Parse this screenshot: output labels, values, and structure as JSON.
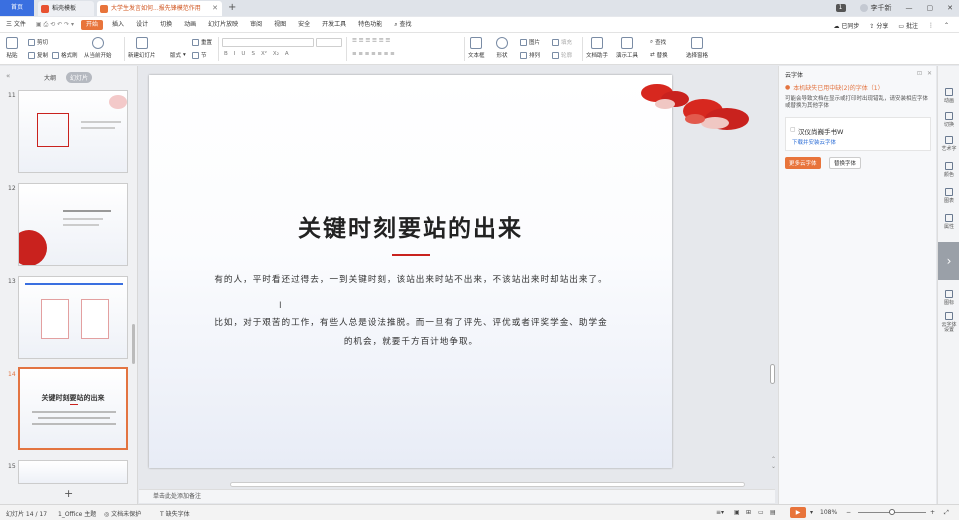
{
  "tabs": {
    "home": "首页",
    "docer": "稻壳模板",
    "ppt": "大学生发言如何...报先锋模范作用"
  },
  "window": {
    "badge": "1",
    "user": "李千新"
  },
  "menu": {
    "file": "三 文件",
    "items": [
      "开始",
      "插入",
      "设计",
      "切换",
      "动画",
      "幻灯片放映",
      "审阅",
      "视图",
      "安全",
      "开发工具",
      "特色功能"
    ],
    "search": "查找",
    "right": [
      "已同步",
      "分享",
      "批注"
    ]
  },
  "ribbon": {
    "paste": "粘贴",
    "cut": "剪切",
    "copy": "复制",
    "format_painter": "格式刷",
    "from_current": "从当前开始",
    "new_slide": "新建幻灯片",
    "layout": "版式",
    "section": "节",
    "reset": "重置",
    "font_tools": [
      "B",
      "I",
      "U",
      "S",
      "X²",
      "X₂",
      "A"
    ],
    "shape_group": [
      "图片",
      "填充",
      "排列",
      "轮廓"
    ],
    "textbox": "文本框",
    "shape": "形状",
    "wenda": "文档助手",
    "presentation_tools": "演示工具",
    "find": "查找",
    "replace": "替换",
    "select_pane": "选择窗格"
  },
  "left_panel": {
    "tab_outline": "大纲",
    "tab_slides": "幻灯片",
    "slides": [
      {
        "num": "11",
        "title": "平时看还过得去"
      },
      {
        "num": "12",
        "title": "比如，对于艰苦的工作"
      },
      {
        "num": "13",
        "title": ""
      },
      {
        "num": "14",
        "title": "关键时刻要站的出来"
      },
      {
        "num": "15",
        "title": ""
      }
    ]
  },
  "slide": {
    "title": "关键时刻要站的出来",
    "para1": "有的人，平时看还过得去，一到关键时刻，该站出来时站不出来，不该站出来时却站出来了。",
    "para2": "比如，对于艰苦的工作，有些人总是设法推脱。而一旦有了评先、评优或者评奖学金、助学金的机会，就要千方百计地争取。"
  },
  "notes": "单击此处添加备注",
  "right_panel": {
    "title": "云字体",
    "warning": "本机缺失已用中缺(2)的字体（1）",
    "desc": "可能会导致文档在显示或打印时出现错乱，请安装相应字体或替换为其他字体",
    "font": "汉仪尚巍手书W",
    "link": "下载并安装云字体",
    "btn_more": "更多云字体",
    "btn_replace": "替换字体"
  },
  "side_tools": [
    "动画",
    "切换",
    "艺术字",
    "颜色",
    "图表",
    "属性",
    "图标",
    "云字体",
    "设置"
  ],
  "status": {
    "slide_count": "幻灯片 14 / 17",
    "theme": "1_Office 主题",
    "backup": "文档未保护",
    "missing": "缺失字体",
    "zoom": "108%"
  },
  "colors": {
    "accent": "#e8743b",
    "title_red": "#c9221e",
    "home_blue": "#3a6fe0"
  }
}
